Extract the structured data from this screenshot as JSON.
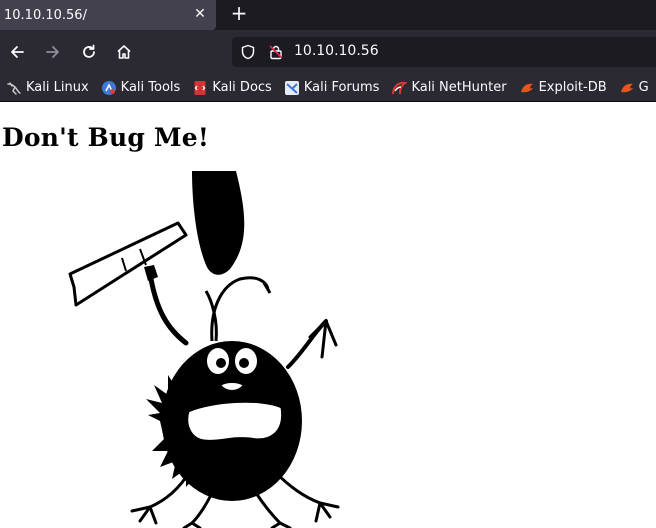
{
  "browser": {
    "tab": {
      "title": "10.10.10.56/",
      "close_glyph": "✕"
    },
    "new_tab_glyph": "+",
    "address": {
      "url": "10.10.10.56"
    },
    "bookmarks": [
      {
        "label": "Kali Linux",
        "icon": "kali-dragon-icon",
        "color": "#c0c0c0"
      },
      {
        "label": "Kali Tools",
        "icon": "kali-tools-icon",
        "color": "#3d7ad8"
      },
      {
        "label": "Kali Docs",
        "icon": "kali-docs-icon",
        "color": "#d23535"
      },
      {
        "label": "Kali Forums",
        "icon": "kali-forums-icon",
        "color": "#3d7ad8"
      },
      {
        "label": "Kali NetHunter",
        "icon": "nethunter-icon",
        "color": "#d23535"
      },
      {
        "label": "Exploit-DB",
        "icon": "exploit-db-icon",
        "color": "#e8541e"
      },
      {
        "label": "G",
        "icon": "ghdb-icon",
        "color": "#e8541e"
      }
    ],
    "colors": {
      "chrome_dark": "#1c1b22",
      "toolbar": "#2b2a33",
      "tab_active": "#42414d"
    }
  },
  "page": {
    "heading": "Don't Bug Me!",
    "image": "cartoon-bug-with-hammer"
  }
}
